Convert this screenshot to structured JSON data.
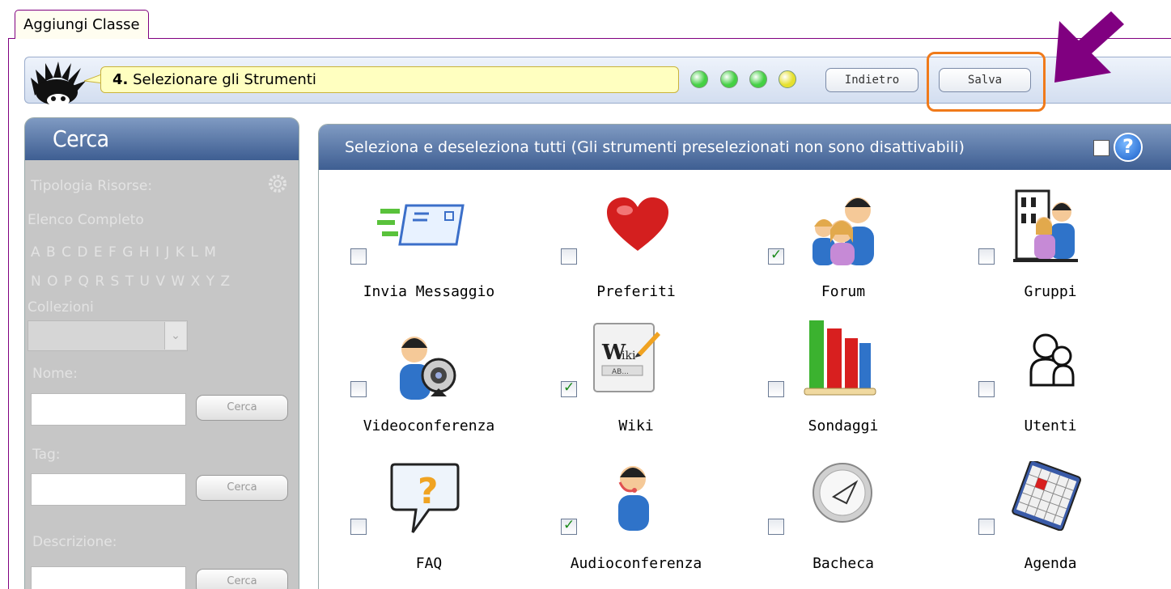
{
  "tab": {
    "label": "Aggiungi Classe"
  },
  "wizard": {
    "step_number": "4.",
    "step_title": " Selezionare gli Strumenti",
    "progress_dots": [
      "#44d044",
      "#44d044",
      "#44d044",
      "#e6e02e"
    ],
    "back_label": "Indietro",
    "save_label": "Salva"
  },
  "search_panel": {
    "title": "Cerca",
    "resource_type_label": "Tipologia Risorse:",
    "full_list_label": "Elenco Completo",
    "alphabet_row1": "A B C D E F G H I J  K L M",
    "alphabet_row2": "N O P Q R S T U V W X Y Z",
    "collections_label": "Collezioni",
    "name_label": "Nome:",
    "tag_label": "Tag:",
    "description_label": "Descrizione:",
    "search_button": "Cerca"
  },
  "tools_panel": {
    "header": "Seleziona e deseleziona tutti (Gli strumenti preselezionati non sono disattivabili)",
    "tools": [
      {
        "label": "Invia Messaggio",
        "icon": "send-message-icon",
        "checked": false
      },
      {
        "label": "Preferiti",
        "icon": "heart-icon",
        "checked": false
      },
      {
        "label": "Forum",
        "icon": "forum-people-icon",
        "checked": true
      },
      {
        "label": "Gruppi",
        "icon": "groups-building-icon",
        "checked": false
      },
      {
        "label": "Videoconferenza",
        "icon": "webcam-user-icon",
        "checked": false
      },
      {
        "label": "Wiki",
        "icon": "wiki-pencil-icon",
        "checked": true
      },
      {
        "label": "Sondaggi",
        "icon": "bar-chart-icon",
        "checked": false
      },
      {
        "label": "Utenti",
        "icon": "users-outline-icon",
        "checked": false
      },
      {
        "label": "FAQ",
        "icon": "question-bubble-icon",
        "checked": false
      },
      {
        "label": "Audioconferenza",
        "icon": "headset-user-icon",
        "checked": true
      },
      {
        "label": "Bacheca",
        "icon": "compass-clock-icon",
        "checked": false
      },
      {
        "label": "Agenda",
        "icon": "calendar-icon",
        "checked": false
      }
    ]
  }
}
